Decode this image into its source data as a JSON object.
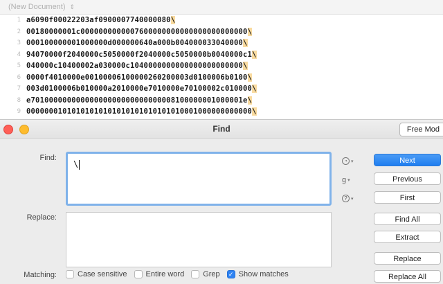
{
  "document": {
    "title": "(New Document)",
    "chevron": "⇕",
    "lines": [
      {
        "num": "1",
        "text": "a6090f00022203af0900007740000080",
        "tail": "\\"
      },
      {
        "num": "2",
        "text": "00180000001c0000000000007600000000000000000000000",
        "tail": "\\"
      },
      {
        "num": "3",
        "text": "000100000001000000d000000640a000b004000033040000",
        "tail": "\\"
      },
      {
        "num": "4",
        "text": "94070000f2040000c5050000f2040000c5050000b0040000c1",
        "tail": "\\"
      },
      {
        "num": "5",
        "text": "040000c10400002a030000c1040000000000000000000000",
        "tail": "\\"
      },
      {
        "num": "6",
        "text": "0000f4010000e00100006100000260200003d0100006b0100",
        "tail": "\\"
      },
      {
        "num": "7",
        "text": "003d0100006b010000a2010000e7010000e70100002c010000",
        "tail": "\\"
      },
      {
        "num": "8",
        "text": "e70100000000000000000000000000008100000001000001e",
        "tail": "\\"
      },
      {
        "num": "9",
        "text": "00000001010101010101010101010101010001000000000000",
        "tail": "\\"
      }
    ]
  },
  "find_panel": {
    "title": "Find",
    "free_mode": "Free Mod",
    "find_label": "Find:",
    "find_value": "\\",
    "replace_label": "Replace:",
    "matching_label": "Matching:",
    "buttons": {
      "next": "Next",
      "previous": "Previous",
      "first": "First",
      "find_all": "Find All",
      "extract": "Extract",
      "replace": "Replace",
      "replace_all": "Replace All"
    },
    "options": {
      "case_sensitive": "Case sensitive",
      "entire_word": "Entire word",
      "grep": "Grep",
      "show_matches": "Show matches"
    },
    "icons": {
      "history": "clock-icon",
      "grep_pattern": "grep-pattern-icon",
      "help": "help-icon"
    },
    "accent_color": "#1f7ef0"
  }
}
